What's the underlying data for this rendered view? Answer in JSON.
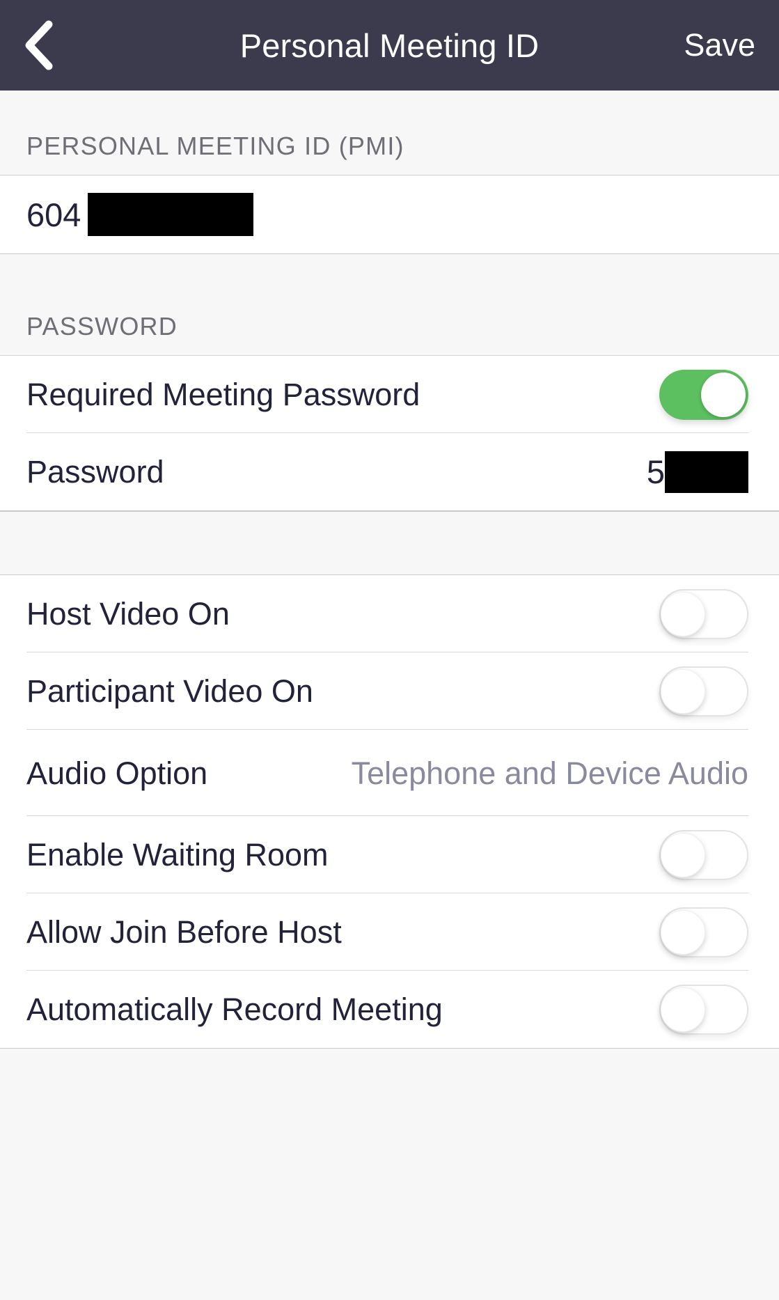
{
  "navbar": {
    "back_icon": "chevron-left-icon",
    "title": "Personal Meeting ID",
    "save_label": "Save"
  },
  "sections": {
    "pmi": {
      "header": "PERSONAL MEETING ID (PMI)",
      "value_visible": "604",
      "value_redacted": true
    },
    "password": {
      "header": "PASSWORD",
      "rows": [
        {
          "label": "Required Meeting Password",
          "control": "toggle",
          "state": "on"
        },
        {
          "label": "Password",
          "control": "redacted-value",
          "value_visible": "5",
          "value_redacted": true
        }
      ]
    },
    "options": {
      "rows": [
        {
          "label": "Host Video On",
          "control": "toggle",
          "state": "off"
        },
        {
          "label": "Participant Video On",
          "control": "toggle",
          "state": "off"
        },
        {
          "label": "Audio Option",
          "control": "value",
          "value": "Telephone and Device Audio"
        },
        {
          "label": "Enable Waiting Room",
          "control": "toggle",
          "state": "off"
        },
        {
          "label": "Allow Join Before Host",
          "control": "toggle",
          "state": "off"
        },
        {
          "label": "Automatically Record Meeting",
          "control": "toggle",
          "state": "off"
        }
      ]
    }
  },
  "colors": {
    "navbar_background": "#3b3b4d",
    "toggle_on": "#5cbf60",
    "page_background": "#f7f7f7",
    "row_background": "#ffffff",
    "label_text": "#22223a",
    "value_text": "#8a8a9e",
    "section_header_text": "#6e6e76",
    "redaction": "#000000"
  }
}
